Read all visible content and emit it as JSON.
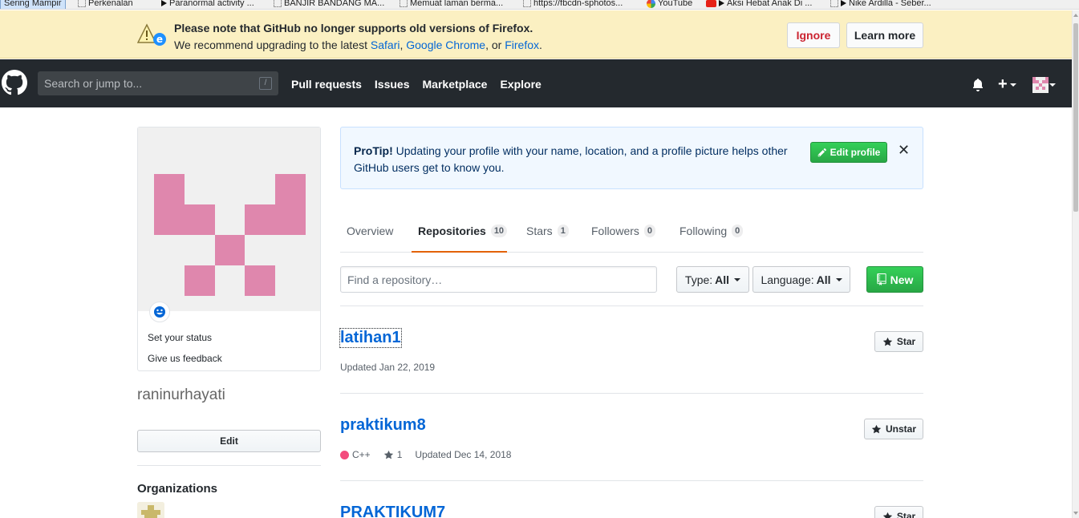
{
  "bookmarks": [
    {
      "label": "Sering Mampir",
      "icon": "page"
    },
    {
      "label": "Perkenalan",
      "icon": "page"
    },
    {
      "label": "Paranormal activity ...",
      "icon": "play"
    },
    {
      "label": "BANJIR BANDANG MA...",
      "icon": "page"
    },
    {
      "label": "Memuat laman berma...",
      "icon": "page"
    },
    {
      "label": "https://fbcdn-sphotos...",
      "icon": "page"
    },
    {
      "label": "YouTube",
      "icon": "google"
    },
    {
      "label": "Aksi Hebat Anak Di ...",
      "icon": "youtube"
    },
    {
      "label": "Nike Ardilla - Seber...",
      "icon": "play"
    }
  ],
  "warning": {
    "title": "Please note that GitHub no longer supports old versions of Firefox.",
    "msg_prefix": "We recommend upgrading to the latest ",
    "link_safari": "Safari",
    "sep1": ", ",
    "link_chrome": "Google Chrome",
    "sep2": ", or ",
    "link_firefox": "Firefox",
    "msg_suffix": ".",
    "ignore_label": "Ignore",
    "learn_label": "Learn more"
  },
  "header": {
    "search_placeholder": "Search or jump to...",
    "slash_hint": "/",
    "nav": [
      "Pull requests",
      "Issues",
      "Marketplace",
      "Explore"
    ],
    "plus_label": "+"
  },
  "sidebar": {
    "set_status": "Set your status",
    "feedback": "Give us feedback",
    "username": "raninurhayati",
    "edit_label": "Edit",
    "orgs_title": "Organizations"
  },
  "protip": {
    "lead": "ProTip!",
    "text": " Updating your profile with your name, location, and a profile picture helps other GitHub users get to know you.",
    "edit_profile_label": "Edit profile",
    "close_label": "✕"
  },
  "tabs": [
    {
      "label": "Overview",
      "count": null,
      "selected": false
    },
    {
      "label": "Repositories",
      "count": "10",
      "selected": true
    },
    {
      "label": "Stars",
      "count": "1",
      "selected": false
    },
    {
      "label": "Followers",
      "count": "0",
      "selected": false
    },
    {
      "label": "Following",
      "count": "0",
      "selected": false
    }
  ],
  "filters": {
    "find_placeholder": "Find a repository…",
    "type_label": "Type:",
    "type_value": "All",
    "language_label": "Language:",
    "language_value": "All",
    "new_label": "New"
  },
  "repos": [
    {
      "name": "latihan1",
      "language": "",
      "language_color": "",
      "stars": "",
      "updated": "Updated Jan 22, 2019",
      "star_button": "Star"
    },
    {
      "name": "praktikum8",
      "language": "C++",
      "language_color": "#f34b7d",
      "stars": "1",
      "updated": "Updated Dec 14, 2018",
      "star_button": "Unstar"
    },
    {
      "name": "PRAKTIKUM7",
      "language": "",
      "language_color": "",
      "stars": "",
      "updated": "",
      "star_button": "Star"
    }
  ],
  "colors": {
    "accent_blue": "#0366d6",
    "green": "#28a745",
    "tab_underline": "#e36209",
    "identicon": "#df87ad",
    "header_bg": "#24292e",
    "warning_bg": "#fbf0c2"
  }
}
